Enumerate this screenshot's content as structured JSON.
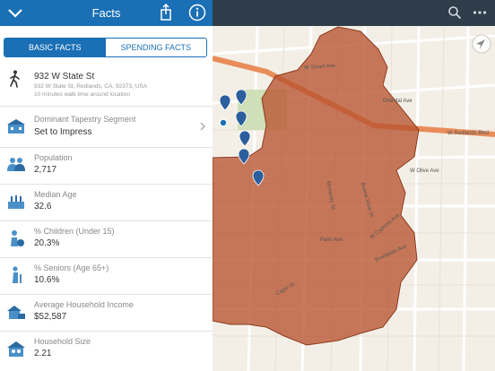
{
  "header": {
    "title": "Facts"
  },
  "tabs": {
    "basic": "BASIC FACTS",
    "spending": "SPENDING FACTS"
  },
  "location": {
    "name": "932 W State St",
    "address": "932 W State St, Redlands, CA, 92373, USA",
    "note": "10 minutes walk time around location"
  },
  "facts": [
    {
      "label": "Dominant Tapestry Segment",
      "value": "Set to Impress",
      "icon": "house-segment-icon"
    },
    {
      "label": "Population",
      "value": "2,717",
      "icon": "people-icon"
    },
    {
      "label": "Median Age",
      "value": "32.6",
      "icon": "age-icon"
    },
    {
      "label": "% Children (Under 15)",
      "value": "20.3%",
      "icon": "child-icon"
    },
    {
      "label": "% Seniors (Age 65+)",
      "value": "10.6%",
      "icon": "senior-icon"
    },
    {
      "label": "Average Household Income",
      "value": "$52,587",
      "icon": "income-icon"
    },
    {
      "label": "Household Size",
      "value": "2.21",
      "icon": "household-icon"
    }
  ],
  "map": {
    "streets": [
      "W Stuart Ave",
      "Oriental Ave",
      "W Redlands Blvd",
      "W Olive Ave",
      "W Cypress Ave",
      "Brookside Ave",
      "Palm Ave",
      "Cajon St",
      "Monterey St",
      "Buena Vista St"
    ],
    "colors": {
      "area_fill": "#b9532f",
      "accent": "#1a6fb5"
    }
  }
}
